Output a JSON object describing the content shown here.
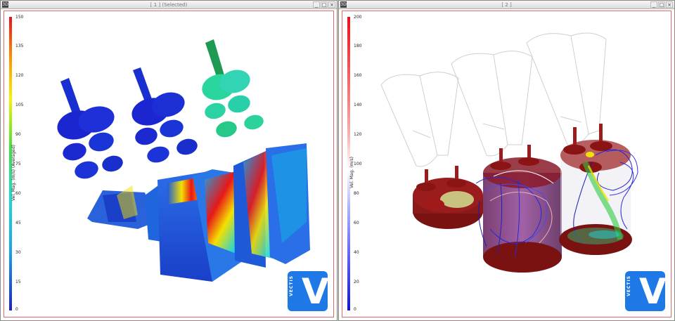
{
  "left_window": {
    "title": "[ 1 ] (Selected)",
    "app_icon_label": "3D",
    "controls": [
      "_",
      "□",
      "×"
    ],
    "legend": {
      "title": "Vel. Mag. (m/s) (Averaged)",
      "ticks": [
        "150",
        "135",
        "120",
        "105",
        "90",
        "75",
        "60",
        "45",
        "30",
        "15",
        "0"
      ],
      "colors": [
        "#e8111a",
        "#ff9a00",
        "#f4f400",
        "#3fdf3f",
        "#21d6d6",
        "#1aa3e6",
        "#2020c8"
      ]
    },
    "logo": {
      "mark": "V",
      "text": "VECTIS"
    }
  },
  "right_window": {
    "title": "[ 2 ]",
    "app_icon_label": "3D",
    "controls": [
      "_",
      "□",
      "×"
    ],
    "legend": {
      "title": "Vel. Mag. (m/s)",
      "ticks": [
        "200",
        "180",
        "160",
        "140",
        "120",
        "100",
        "80",
        "60",
        "40",
        "20",
        "0"
      ],
      "colors": [
        "#e8111a",
        "#f26060",
        "#f7b0b0",
        "#ffffff",
        "#b0b0ff",
        "#6060f0",
        "#1515d0"
      ]
    },
    "logo": {
      "mark": "V",
      "text": "VECTIS"
    }
  }
}
